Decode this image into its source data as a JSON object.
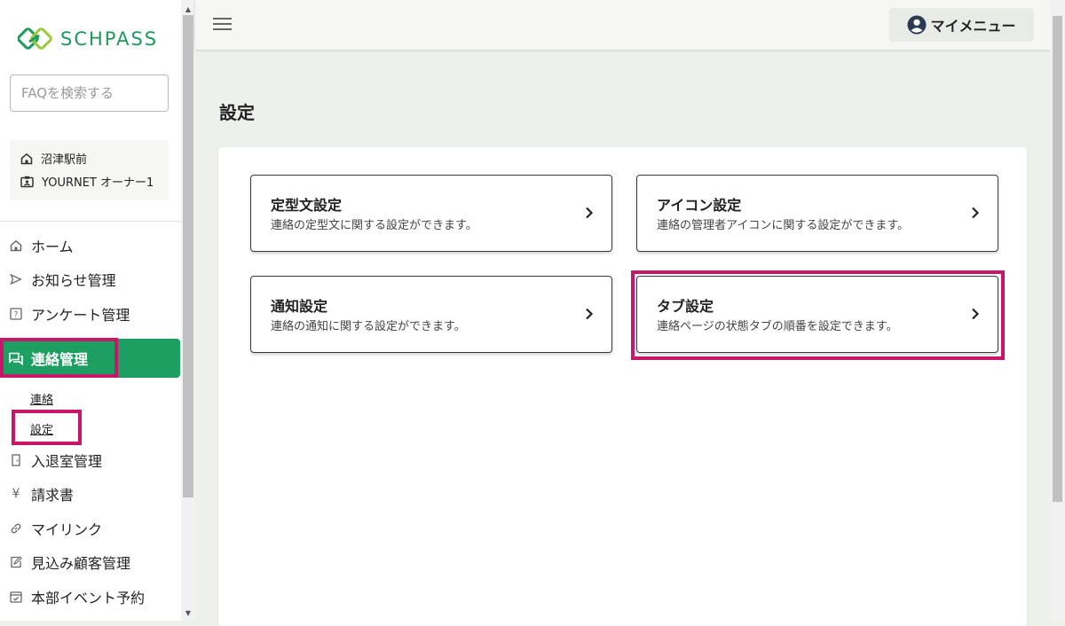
{
  "brand": {
    "name": "SCHPASS",
    "color": "#1d9a5c"
  },
  "search": {
    "placeholder": "FAQを検索する"
  },
  "store": {
    "location": "沼津駅前",
    "user": "YOURNET オーナー1"
  },
  "nav": {
    "home": "ホーム",
    "notice": "お知らせ管理",
    "survey": "アンケート管理",
    "contact": "連絡管理",
    "contact_sub": {
      "contact": "連絡",
      "settings": "設定"
    },
    "entry": "入退室管理",
    "billing": "請求書",
    "mylink": "マイリンク",
    "prospect": "見込み顧客管理",
    "event": "本部イベント予約"
  },
  "header": {
    "my_menu": "マイメニュー"
  },
  "page": {
    "title": "設定"
  },
  "cards": [
    {
      "title": "定型文設定",
      "desc": "連絡の定型文に関する設定ができます。"
    },
    {
      "title": "アイコン設定",
      "desc": "連絡の管理者アイコンに関する設定ができます。"
    },
    {
      "title": "通知設定",
      "desc": "連絡の通知に関する設定ができます。"
    },
    {
      "title": "タブ設定",
      "desc": "連絡ページの状態タブの順番を設定できます。"
    }
  ],
  "colors": {
    "accent": "#1d9f61",
    "highlight": "#c8166a"
  }
}
